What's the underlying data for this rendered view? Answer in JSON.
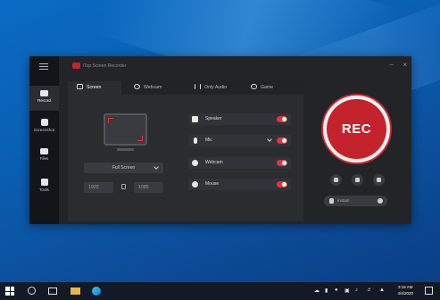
{
  "app": {
    "title": "iTop Screen Recorder",
    "sidebar": [
      {
        "label": "Record",
        "icon": "camera-icon",
        "active": true
      },
      {
        "label": "Screenshot",
        "icon": "screenshot-icon",
        "active": false
      },
      {
        "label": "Files",
        "icon": "folder-icon",
        "active": false
      },
      {
        "label": "Tools",
        "icon": "tools-icon",
        "active": false
      }
    ],
    "tabs": [
      {
        "label": "Screen",
        "icon": "monitor-icon",
        "active": true
      },
      {
        "label": "Webcam",
        "icon": "webcam-icon",
        "active": false
      },
      {
        "label": "Only Audio",
        "icon": "audio-wave-icon",
        "active": false
      },
      {
        "label": "Game",
        "icon": "gamepad-icon",
        "active": false
      }
    ],
    "capture": {
      "mode": "Full Screen",
      "width": "1920",
      "height": "1080"
    },
    "options": [
      {
        "label": "Speaker",
        "icon": "speaker-icon",
        "enabled": true
      },
      {
        "label": "Mic",
        "icon": "mic-icon",
        "enabled": true
      },
      {
        "label": "Webcam",
        "icon": "webcam-icon",
        "enabled": true
      },
      {
        "label": "Mouse",
        "icon": "mouse-icon",
        "enabled": true
      }
    ],
    "rec_label": "REC",
    "small_buttons": [
      "home-icon",
      "screenshot-icon",
      "timer-icon"
    ],
    "instant_label": "Instant",
    "accent": "#c4232b"
  },
  "taskbar": {
    "time": "3:16 AM",
    "date": "4/4/2020",
    "tray_icons": [
      "cloud-icon",
      "usb-icon",
      "color-icon",
      "volume-icon",
      "network-icon",
      "speaker-icon",
      "notification-icon"
    ]
  }
}
